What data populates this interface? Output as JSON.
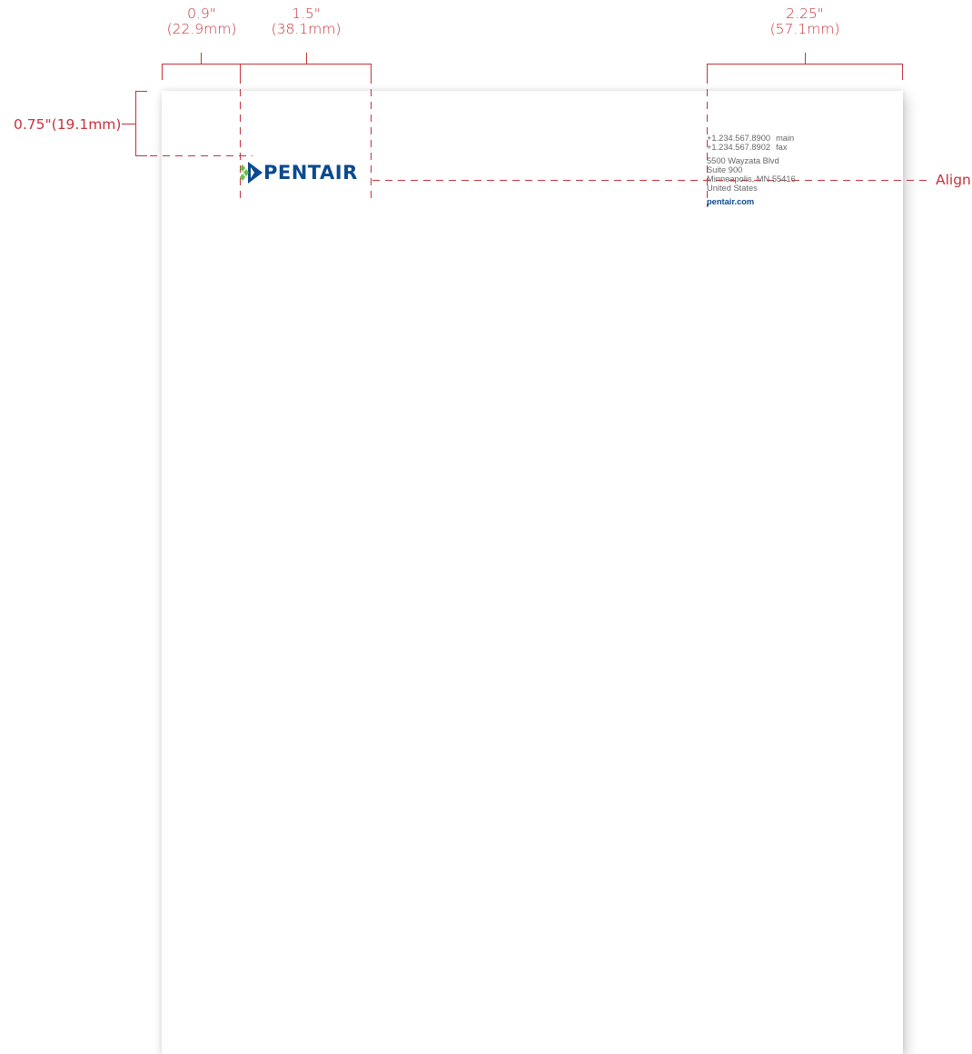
{
  "dimensions": {
    "left_margin": {
      "inches": "0.9\"",
      "mm": "(22.9mm)"
    },
    "logo_width": {
      "inches": "1.5\"",
      "mm": "(38.1mm)"
    },
    "contact_width": {
      "inches": "2.25\"",
      "mm": "(57.1mm)"
    },
    "top_margin": "0.75\"(19.1mm)",
    "align_label": "Align"
  },
  "logo": {
    "wordmark": "PENTAIR",
    "icon": "pentair-diamond-logo-icon"
  },
  "contact": {
    "phone_main": "+1.234.567.8900",
    "phone_main_label": "main",
    "phone_fax": "+1.234.567.8902",
    "phone_fax_label": "fax",
    "address_line1": "5500 Wayzata Blvd",
    "address_line2": "Suite 900",
    "address_line3": "Minneapolis, MN 55416",
    "address_line4": "United States",
    "website": "pentair.com"
  },
  "colors": {
    "guide": "#c8323a",
    "brand_blue": "#0b4a8f",
    "brand_green": "#6abf4b"
  }
}
